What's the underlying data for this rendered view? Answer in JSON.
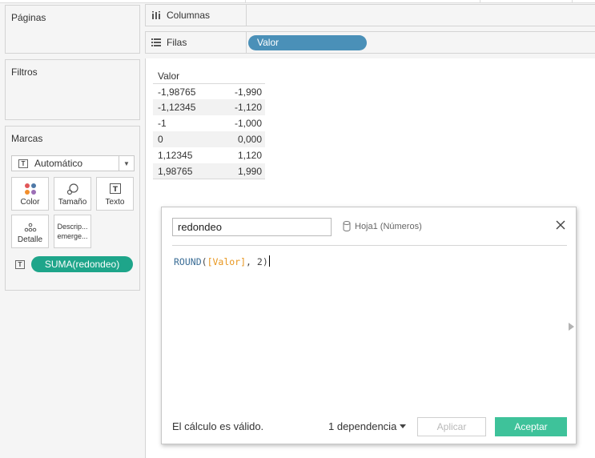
{
  "left_panel": {
    "pages_title": "Páginas",
    "filters_title": "Filtros",
    "marks": {
      "title": "Marcas",
      "mark_type": "Automático",
      "buttons": [
        {
          "label": "Color",
          "icon": "color-dots-icon"
        },
        {
          "label": "Tamaño",
          "icon": "size-icon"
        },
        {
          "label": "Texto",
          "icon": "text-icon"
        },
        {
          "label": "Detalle",
          "icon": "detail-icon"
        },
        {
          "label": "Descrip... emerge...",
          "icon": ""
        }
      ],
      "pill_label": "SUMA(redondeo)",
      "pill_icon": "text-icon"
    }
  },
  "shelves": {
    "columns_label": "Columnas",
    "columns_icon": "columns-icon",
    "rows_label": "Filas",
    "rows_icon": "rows-icon",
    "rows_pill": "Valor"
  },
  "table": {
    "header": "Valor",
    "rows": [
      {
        "valor": "-1,98765",
        "value": "-1,990"
      },
      {
        "valor": "-1,12345",
        "value": "-1,120"
      },
      {
        "valor": "-1",
        "value": "-1,000"
      },
      {
        "valor": "0",
        "value": "0,000"
      },
      {
        "valor": "1,12345",
        "value": "1,120"
      },
      {
        "valor": "1,98765",
        "value": "1,990"
      }
    ]
  },
  "calc_dialog": {
    "name": "redondeo",
    "datasource": "Hoja1 (Números)",
    "formula": {
      "fn": "ROUND",
      "open": "(",
      "field": "[Valor]",
      "sep": ", ",
      "num": "2",
      "close": ")"
    },
    "status": "El cálculo es válido.",
    "dependency": "1 dependencia",
    "apply_label": "Aplicar",
    "accept_label": "Aceptar"
  },
  "colors": {
    "rows_pill": "#4a90b8",
    "measure_pill": "#1ea58a",
    "accept_button": "#3ec29a",
    "formula_function": "#3b6d96",
    "formula_field": "#e8961e"
  }
}
